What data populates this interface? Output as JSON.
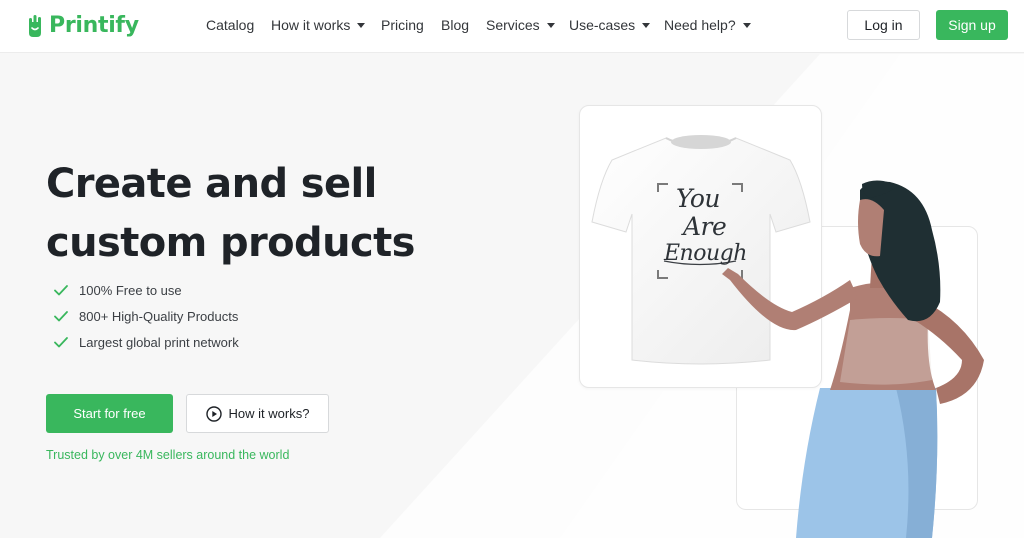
{
  "brand": {
    "name": "Printify",
    "color": "#39b75d"
  },
  "nav": {
    "items": [
      {
        "label": "Catalog",
        "dropdown": false
      },
      {
        "label": "How it works",
        "dropdown": true
      },
      {
        "label": "Pricing",
        "dropdown": false
      },
      {
        "label": "Blog",
        "dropdown": false
      },
      {
        "label": "Services",
        "dropdown": true
      },
      {
        "label": "Use-cases",
        "dropdown": true
      },
      {
        "label": "Need help?",
        "dropdown": true
      }
    ],
    "login_label": "Log in",
    "signup_label": "Sign up"
  },
  "hero": {
    "title_line1": "Create and sell",
    "title_line2": "custom products",
    "features": [
      "100% Free to use",
      "800+ High-Quality Products",
      "Largest global print network"
    ],
    "start_label": "Start for free",
    "how_label": "How it works?",
    "trusted_text": "Trusted by over 4M sellers around the world"
  },
  "illustration": {
    "shirt_text": [
      "You",
      "Are",
      "Enough"
    ]
  },
  "colors": {
    "accent": "#39b75d",
    "skirt": "#9cc4e8",
    "skin": "#b07f74",
    "hair": "#1f2f33"
  },
  "icons": [
    "logo-icon",
    "caret-down-icon",
    "check-icon",
    "play-icon"
  ]
}
